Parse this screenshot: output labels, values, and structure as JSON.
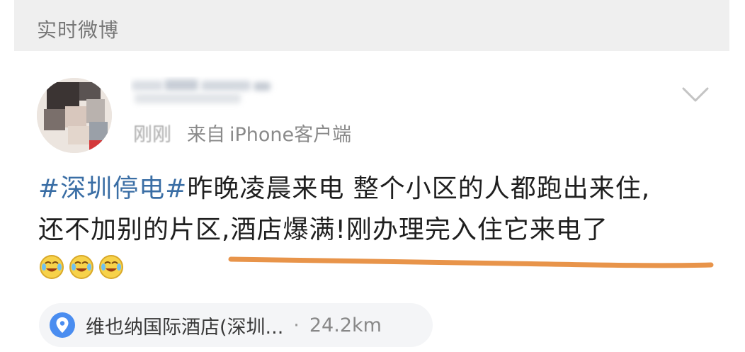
{
  "section": {
    "title": "实时微博"
  },
  "post": {
    "meta": {
      "time": "刚刚",
      "source_prefix": "来自",
      "source": "iPhone客户端"
    },
    "hashtag": "#深圳停电#",
    "text_line1": "昨晚凌晨来电 整个小区的人都跑出来住,",
    "text_line2": "还不加别的片区,酒店爆满!刚办理完入住它来电了",
    "emojis": [
      "laugh-cry-emoji",
      "laugh-cry-emoji",
      "laugh-cry-emoji"
    ],
    "location": {
      "icon": "location-pin-icon",
      "name": "维也纳国际酒店(深圳...",
      "separator": "·",
      "distance": "24.2km"
    }
  },
  "colors": {
    "header_bg": "#efefef",
    "hashtag": "#3a6ea5",
    "pin": "#4a8df0",
    "underline_mark": "#e8944a"
  }
}
